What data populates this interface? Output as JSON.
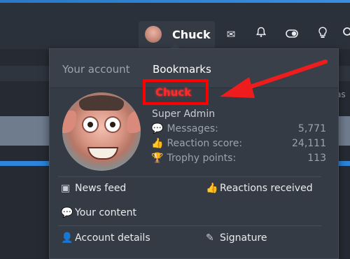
{
  "header": {
    "username": "Chuck"
  },
  "tabs": [
    {
      "label": "Your account"
    },
    {
      "label": "Bookmarks"
    }
  ],
  "profile": {
    "name": "Chuck",
    "role": "Super Admin",
    "stats": [
      {
        "label": "Messages:",
        "value": "5,771"
      },
      {
        "label": "Reaction score:",
        "value": "24,111"
      },
      {
        "label": "Trophy points:",
        "value": "113"
      }
    ]
  },
  "links": {
    "news_feed": "News feed",
    "reactions_received": "Reactions received",
    "your_content": "Your content",
    "account_details": "Account details",
    "signature": "Signature"
  },
  "background": {
    "partial_text": "as"
  },
  "colors": {
    "accent": "#2d84da",
    "highlight": "#ff0000"
  }
}
